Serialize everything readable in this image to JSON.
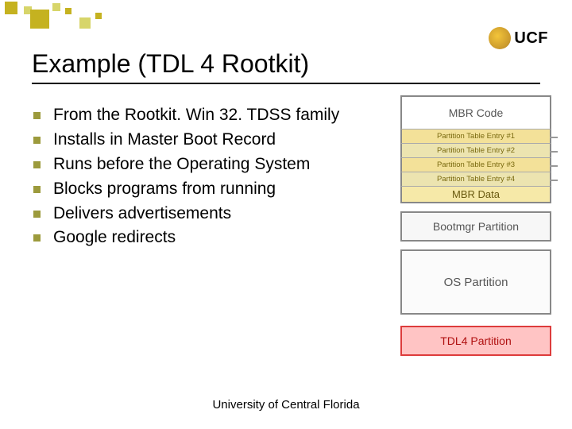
{
  "logo": {
    "text": "UCF"
  },
  "title": "Example (TDL 4 Rootkit)",
  "bullets": [
    "From the Rootkit. Win 32. TDSS family",
    "Installs in Master Boot Record",
    "Runs before the Operating System",
    "Blocks programs from running",
    "Delivers advertisements",
    "Google redirects"
  ],
  "diagram": {
    "mbr_code": "MBR Code",
    "pte": [
      "Partition Table Entry #1",
      "Partition Table Entry #2",
      "Partition Table Entry #3",
      "Partition Table Entry #4"
    ],
    "mbr_data": "MBR Data",
    "bootmgr": "Bootmgr Partition",
    "os": "OS Partition",
    "tdl4": "TDL4 Partition"
  },
  "footer": "University of Central Florida"
}
